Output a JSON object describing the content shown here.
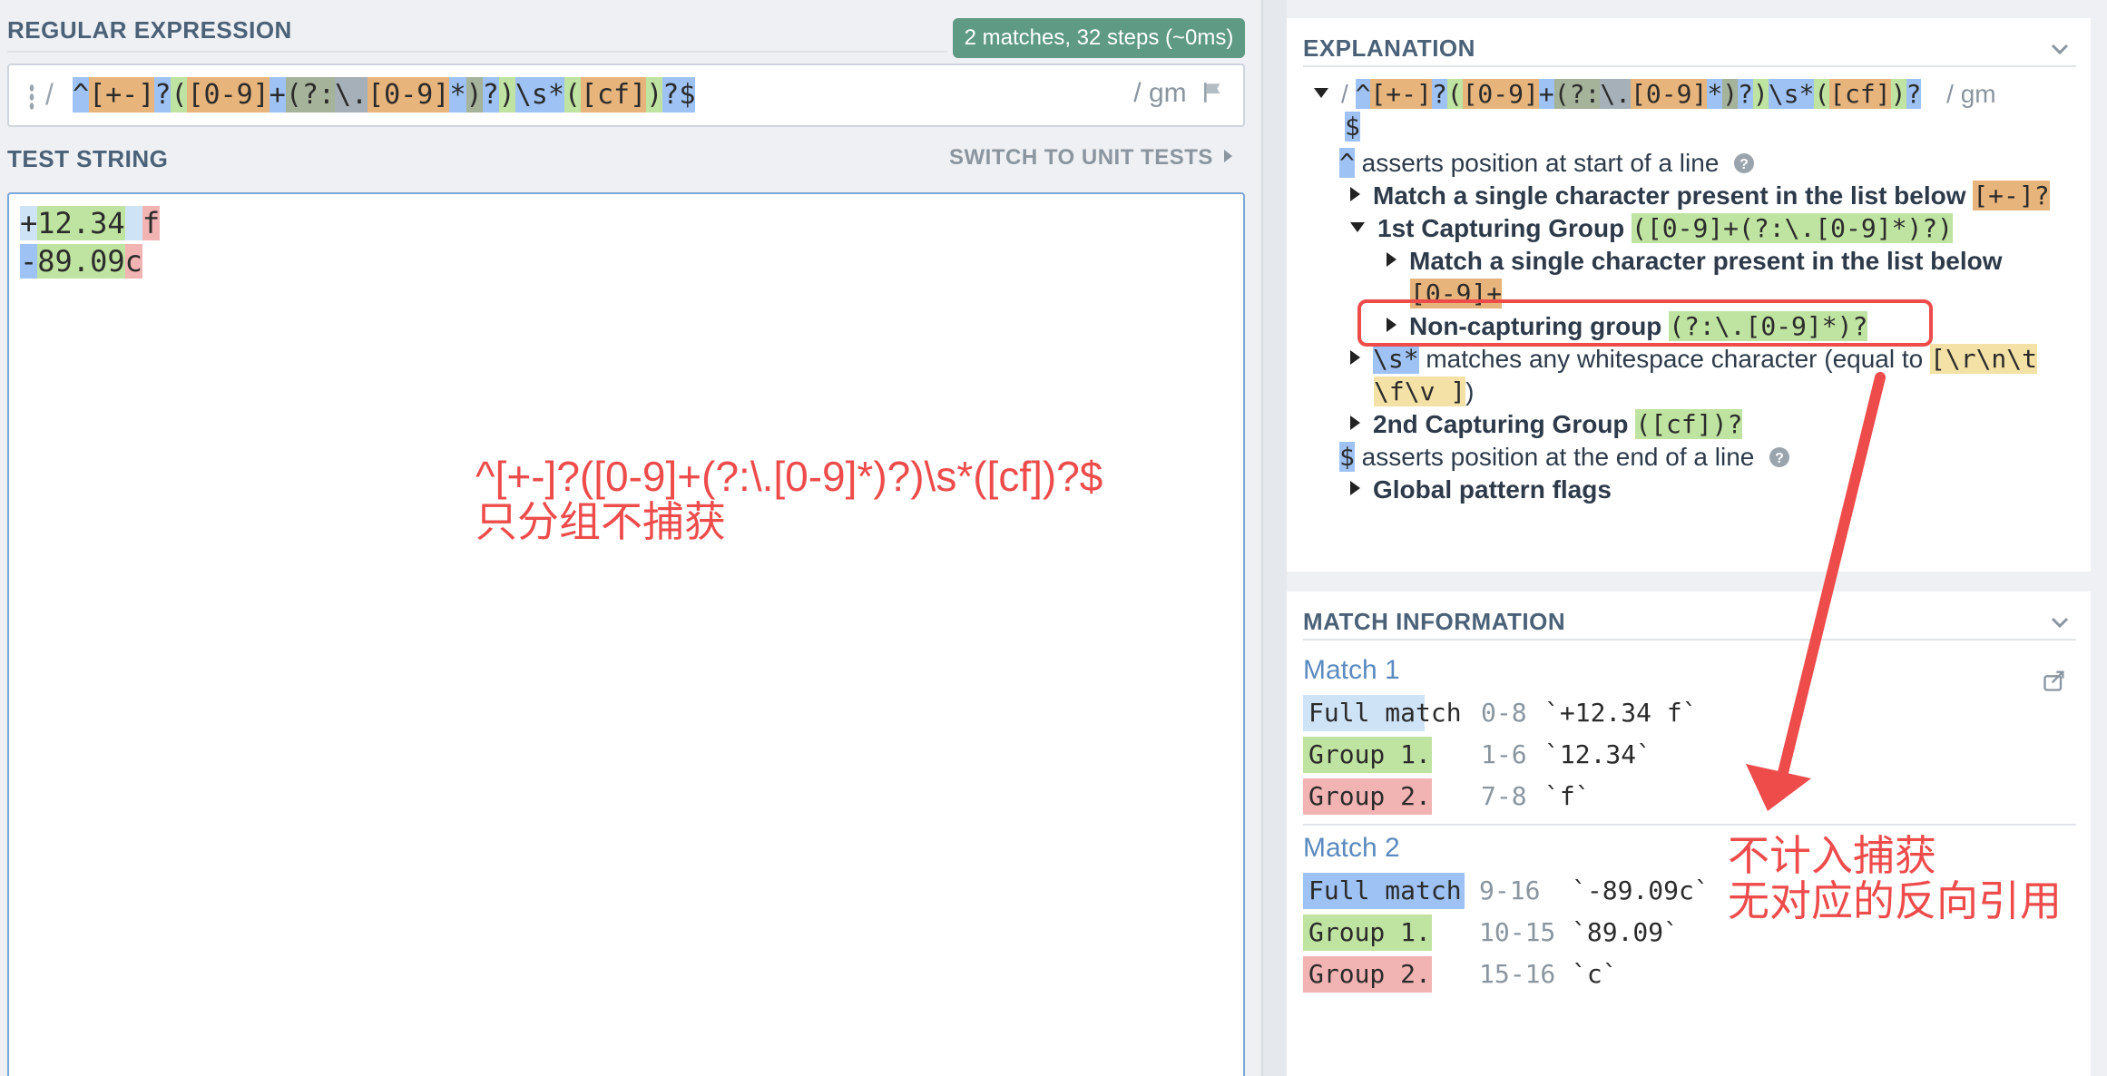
{
  "regex": {
    "label": "REGULAR EXPRESSION",
    "match_summary": "2 matches, 32 steps (~0ms)",
    "open_delimiter": "/",
    "pattern_tokens": [
      {
        "text": "^",
        "kind": "anchor"
      },
      {
        "text": "[+-]",
        "kind": "class"
      },
      {
        "text": "?",
        "kind": "quant"
      },
      {
        "text": "(",
        "kind": "group"
      },
      {
        "text": "[0-9]",
        "kind": "class"
      },
      {
        "text": "+",
        "kind": "quant"
      },
      {
        "text": "(?:",
        "kind": "nc"
      },
      {
        "text": "\\.",
        "kind": "esc"
      },
      {
        "text": "[0-9]",
        "kind": "class"
      },
      {
        "text": "*",
        "kind": "quant"
      },
      {
        "text": ")",
        "kind": "nc"
      },
      {
        "text": "?",
        "kind": "quant"
      },
      {
        "text": ")",
        "kind": "group"
      },
      {
        "text": "\\s",
        "kind": "anchor"
      },
      {
        "text": "*",
        "kind": "quant"
      },
      {
        "text": "(",
        "kind": "group"
      },
      {
        "text": "[cf]",
        "kind": "class"
      },
      {
        "text": ")",
        "kind": "group"
      },
      {
        "text": "?",
        "kind": "quant"
      },
      {
        "text": "$",
        "kind": "anchor"
      }
    ],
    "flags_text": "/ gm"
  },
  "test": {
    "label": "TEST STRING",
    "switch_label": "SWITCH TO UNIT TESTS",
    "line1": [
      {
        "text": "+",
        "kind": "full"
      },
      {
        "text": "12.34",
        "kind": "g1"
      },
      {
        "text": " ",
        "kind": "full"
      },
      {
        "text": "f",
        "kind": "g2"
      }
    ],
    "line2": [
      {
        "text": "-",
        "kind": "full2"
      },
      {
        "text": "89.09",
        "kind": "g1"
      },
      {
        "text": "c",
        "kind": "g2"
      }
    ]
  },
  "annotations": {
    "left_line1": "^[+-]?([0-9]+(?:\\.[0-9]*)?)\\s*([cf])?$",
    "left_line2": "只分组不捕获",
    "right_line1": "不计入捕获",
    "right_line2": "无对应的反向引用"
  },
  "explanation": {
    "title": "EXPLANATION",
    "head_slash": "/",
    "head_pattern_tokens": [
      {
        "text": "^",
        "kind": "anchor"
      },
      {
        "text": "[+-]",
        "kind": "class"
      },
      {
        "text": "?",
        "kind": "quant"
      },
      {
        "text": "(",
        "kind": "group"
      },
      {
        "text": "[0-9]",
        "kind": "class"
      },
      {
        "text": "+",
        "kind": "quant"
      },
      {
        "text": "(?:",
        "kind": "nc"
      },
      {
        "text": "\\.",
        "kind": "esc"
      },
      {
        "text": "[0-9]",
        "kind": "class"
      },
      {
        "text": "*",
        "kind": "quant"
      },
      {
        "text": ")",
        "kind": "nc"
      },
      {
        "text": "?",
        "kind": "quant"
      },
      {
        "text": ")",
        "kind": "group"
      },
      {
        "text": "\\s",
        "kind": "anchor"
      },
      {
        "text": "*",
        "kind": "quant"
      },
      {
        "text": "(",
        "kind": "group"
      },
      {
        "text": "[cf]",
        "kind": "class"
      },
      {
        "text": ")",
        "kind": "group"
      },
      {
        "text": "?",
        "kind": "quant"
      }
    ],
    "head_flags": "/ gm",
    "head_tail": "$",
    "caret_token": "^",
    "caret_text": "asserts position at start of a line",
    "item_single_char": "Match a single character present in the list below",
    "item_single_char_token": "[+-]?",
    "item_group1": "1st Capturing Group",
    "item_group1_token": "([0-9]+(?:\\.[0-9]*)?)",
    "item_group1_child": "Match a single character present in the list below",
    "item_group1_child_token": "[0-9]+",
    "item_noncapture": "Non-capturing group",
    "item_noncapture_token": "(?:\\.[0-9]*)?",
    "item_ws_token": "\\s*",
    "item_ws_text": "matches any whitespace character (equal to",
    "item_ws_class_1": "[\\r\\n\\t",
    "item_ws_class_2": "\\f\\v ]",
    "item_ws_close": ")",
    "item_group2": "2nd Capturing Group",
    "item_group2_token": "([cf])?",
    "dollar_token": "$",
    "dollar_text": "asserts position at the end of a line",
    "item_flags": "Global pattern flags"
  },
  "match_info": {
    "title": "MATCH INFORMATION",
    "matches": [
      {
        "title": "Match 1",
        "rows": [
          {
            "label": "Full match",
            "range": "0-8",
            "value": "`+12.34 f`"
          },
          {
            "label": "Group 1.",
            "range": "1-6",
            "value": "`12.34`"
          },
          {
            "label": "Group 2.",
            "range": "7-8",
            "value": "`f`"
          }
        ]
      },
      {
        "title": "Match 2",
        "rows": [
          {
            "label": "Full match",
            "range": "9-16",
            "value": "`-89.09c`"
          },
          {
            "label": "Group 1.",
            "range": "10-15",
            "value": "`89.09`"
          },
          {
            "label": "Group 2.",
            "range": "15-16",
            "value": "`c`"
          }
        ]
      }
    ]
  },
  "colors": {
    "anchor": "#9ec2f4",
    "class": "#e7b47c",
    "group": "#bfe3a0",
    "noncapture": "#a4b39a",
    "group2": "#f2b3b3",
    "annotation": "#ee4b4b",
    "badge": "#5e9a84"
  },
  "icons": [
    "grip-icon",
    "flag-icon",
    "chevron-down-icon",
    "help-icon",
    "share-icon",
    "caret-right-icon",
    "caret-down-icon"
  ]
}
